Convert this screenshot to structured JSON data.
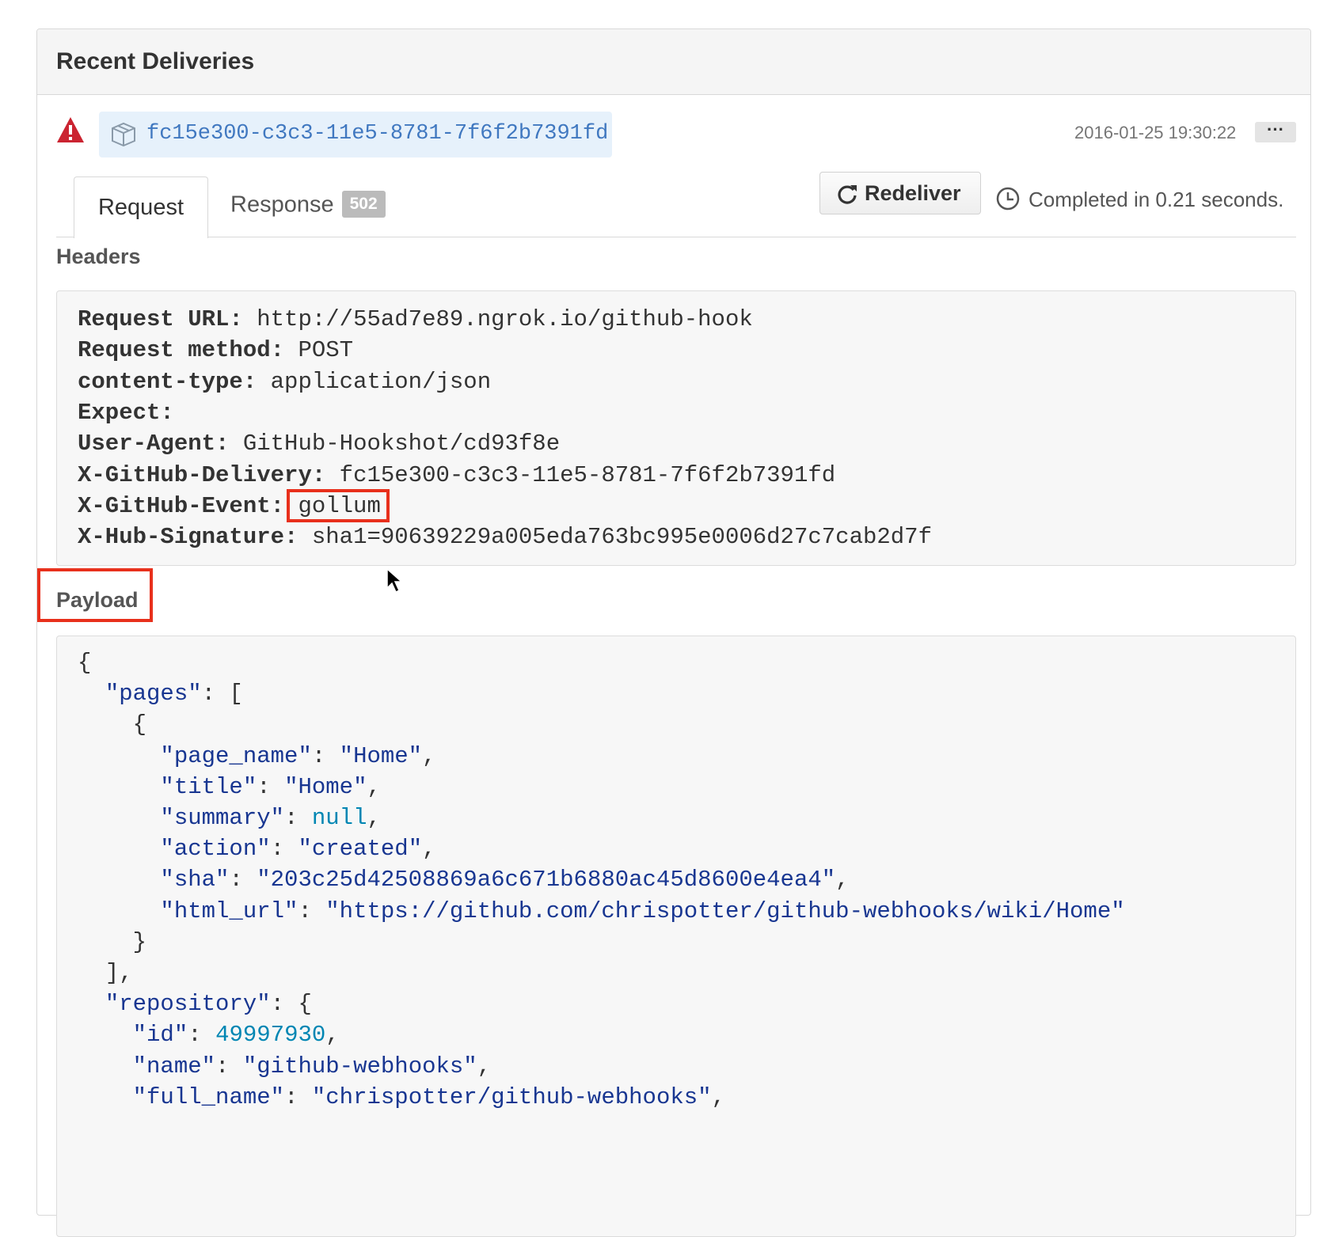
{
  "panel": {
    "title": "Recent Deliveries"
  },
  "delivery": {
    "guid": "fc15e300-c3c3-11e5-8781-7f6f2b7391fd",
    "time": "2016-01-25 19:30:22",
    "more_label": "···",
    "status_icon": "alert-icon",
    "type_icon": "package-icon"
  },
  "tabs": {
    "request": "Request",
    "response": "Response",
    "response_badge": "502"
  },
  "actions": {
    "redeliver_label": "Redeliver",
    "completed_text": "Completed in 0.21 seconds."
  },
  "headers": {
    "title": "Headers",
    "lines": [
      {
        "key": "Request URL:",
        "value": " http://55ad7e89.ngrok.io/github-hook"
      },
      {
        "key": "Request method:",
        "value": " POST"
      },
      {
        "key": "content-type:",
        "value": " application/json"
      },
      {
        "key": "Expect:",
        "value": ""
      },
      {
        "key": "User-Agent:",
        "value": " GitHub-Hookshot/cd93f8e"
      },
      {
        "key": "X-GitHub-Delivery:",
        "value": " fc15e300-c3c3-11e5-8781-7f6f2b7391fd"
      },
      {
        "key": "X-GitHub-Event:",
        "value": " gollum"
      },
      {
        "key": "X-Hub-Signature:",
        "value": " sha1=90639229a005eda763bc995e0006d27c7cab2d7f"
      }
    ]
  },
  "payload": {
    "title": "Payload",
    "lines": [
      {
        "indent": "",
        "parts": [
          {
            "t": "p",
            "v": "{"
          }
        ]
      },
      {
        "indent": "  ",
        "parts": [
          {
            "t": "k",
            "v": "\"pages\""
          },
          {
            "t": "p",
            "v": ": ["
          }
        ]
      },
      {
        "indent": "    ",
        "parts": [
          {
            "t": "p",
            "v": "{"
          }
        ]
      },
      {
        "indent": "      ",
        "parts": [
          {
            "t": "k",
            "v": "\"page_name\""
          },
          {
            "t": "p",
            "v": ": "
          },
          {
            "t": "s",
            "v": "\"Home\""
          },
          {
            "t": "p",
            "v": ","
          }
        ]
      },
      {
        "indent": "      ",
        "parts": [
          {
            "t": "k",
            "v": "\"title\""
          },
          {
            "t": "p",
            "v": ": "
          },
          {
            "t": "s",
            "v": "\"Home\""
          },
          {
            "t": "p",
            "v": ","
          }
        ]
      },
      {
        "indent": "      ",
        "parts": [
          {
            "t": "k",
            "v": "\"summary\""
          },
          {
            "t": "p",
            "v": ": "
          },
          {
            "t": "n",
            "v": "null"
          },
          {
            "t": "p",
            "v": ","
          }
        ]
      },
      {
        "indent": "      ",
        "parts": [
          {
            "t": "k",
            "v": "\"action\""
          },
          {
            "t": "p",
            "v": ": "
          },
          {
            "t": "s",
            "v": "\"created\""
          },
          {
            "t": "p",
            "v": ","
          }
        ]
      },
      {
        "indent": "      ",
        "parts": [
          {
            "t": "k",
            "v": "\"sha\""
          },
          {
            "t": "p",
            "v": ": "
          },
          {
            "t": "s",
            "v": "\"203c25d42508869a6c671b6880ac45d8600e4ea4\""
          },
          {
            "t": "p",
            "v": ","
          }
        ]
      },
      {
        "indent": "      ",
        "parts": [
          {
            "t": "k",
            "v": "\"html_url\""
          },
          {
            "t": "p",
            "v": ": "
          },
          {
            "t": "s",
            "v": "\"https://github.com/chrispotter/github-webhooks/wiki/Home\""
          }
        ]
      },
      {
        "indent": "    ",
        "parts": [
          {
            "t": "p",
            "v": "}"
          }
        ]
      },
      {
        "indent": "  ",
        "parts": [
          {
            "t": "p",
            "v": "],"
          }
        ]
      },
      {
        "indent": "  ",
        "parts": [
          {
            "t": "k",
            "v": "\"repository\""
          },
          {
            "t": "p",
            "v": ": {"
          }
        ]
      },
      {
        "indent": "    ",
        "parts": [
          {
            "t": "k",
            "v": "\"id\""
          },
          {
            "t": "p",
            "v": ": "
          },
          {
            "t": "n",
            "v": "49997930"
          },
          {
            "t": "p",
            "v": ","
          }
        ]
      },
      {
        "indent": "    ",
        "parts": [
          {
            "t": "k",
            "v": "\"name\""
          },
          {
            "t": "p",
            "v": ": "
          },
          {
            "t": "s",
            "v": "\"github-webhooks\""
          },
          {
            "t": "p",
            "v": ","
          }
        ]
      },
      {
        "indent": "    ",
        "parts": [
          {
            "t": "k",
            "v": "\"full_name\""
          },
          {
            "t": "p",
            "v": ": "
          },
          {
            "t": "s",
            "v": "\"chrispotter/github-webhooks\""
          },
          {
            "t": "p",
            "v": ","
          }
        ]
      }
    ]
  },
  "colors": {
    "link": "#4078c0",
    "json_string": "#183691",
    "json_number": "#0086b3",
    "highlight": "#e8301c",
    "warning": "#cb2431"
  }
}
